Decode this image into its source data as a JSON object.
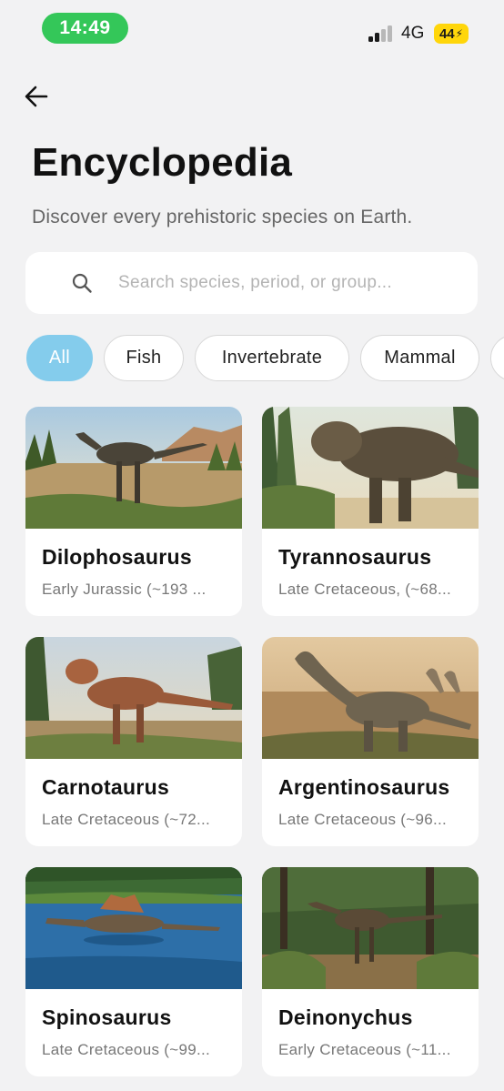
{
  "status": {
    "time": "14:49",
    "network": "4G",
    "battery": "44"
  },
  "header": {
    "title": "Encyclopedia",
    "subtitle": "Discover every prehistoric species on Earth."
  },
  "search": {
    "placeholder": "Search species, period, or group..."
  },
  "filters": [
    "All",
    "Fish",
    "Invertebrate",
    "Mammal"
  ],
  "species": [
    {
      "name": "Dilophosaurus",
      "period": "Early Jurassic (~193 ..."
    },
    {
      "name": "Tyrannosaurus",
      "period": "Late Cretaceous, (~68..."
    },
    {
      "name": "Carnotaurus",
      "period": "Late Cretaceous (~72..."
    },
    {
      "name": "Argentinosaurus",
      "period": "Late Cretaceous (~96..."
    },
    {
      "name": "Spinosaurus",
      "period": "Late Cretaceous (~99..."
    },
    {
      "name": "Deinonychus",
      "period": "Early Cretaceous (~11..."
    }
  ]
}
